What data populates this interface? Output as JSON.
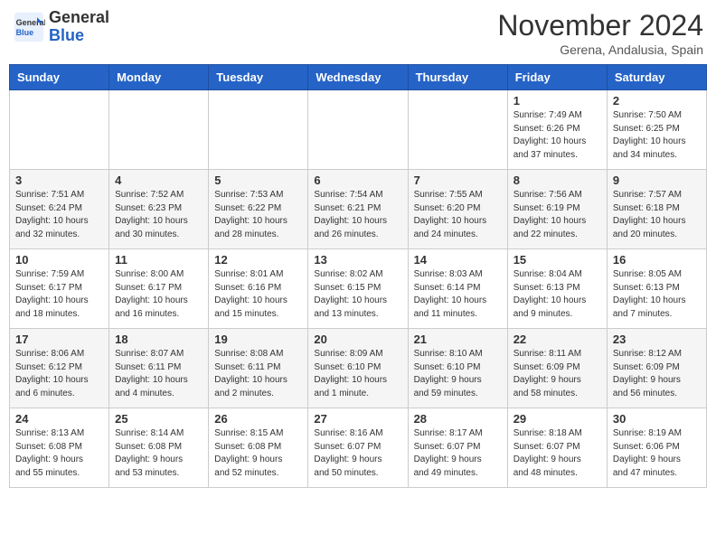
{
  "header": {
    "logo_line1": "General",
    "logo_line2": "Blue",
    "month": "November 2024",
    "location": "Gerena, Andalusia, Spain"
  },
  "weekdays": [
    "Sunday",
    "Monday",
    "Tuesday",
    "Wednesday",
    "Thursday",
    "Friday",
    "Saturday"
  ],
  "weeks": [
    [
      {
        "day": "",
        "info": ""
      },
      {
        "day": "",
        "info": ""
      },
      {
        "day": "",
        "info": ""
      },
      {
        "day": "",
        "info": ""
      },
      {
        "day": "",
        "info": ""
      },
      {
        "day": "1",
        "info": "Sunrise: 7:49 AM\nSunset: 6:26 PM\nDaylight: 10 hours\nand 37 minutes."
      },
      {
        "day": "2",
        "info": "Sunrise: 7:50 AM\nSunset: 6:25 PM\nDaylight: 10 hours\nand 34 minutes."
      }
    ],
    [
      {
        "day": "3",
        "info": "Sunrise: 7:51 AM\nSunset: 6:24 PM\nDaylight: 10 hours\nand 32 minutes."
      },
      {
        "day": "4",
        "info": "Sunrise: 7:52 AM\nSunset: 6:23 PM\nDaylight: 10 hours\nand 30 minutes."
      },
      {
        "day": "5",
        "info": "Sunrise: 7:53 AM\nSunset: 6:22 PM\nDaylight: 10 hours\nand 28 minutes."
      },
      {
        "day": "6",
        "info": "Sunrise: 7:54 AM\nSunset: 6:21 PM\nDaylight: 10 hours\nand 26 minutes."
      },
      {
        "day": "7",
        "info": "Sunrise: 7:55 AM\nSunset: 6:20 PM\nDaylight: 10 hours\nand 24 minutes."
      },
      {
        "day": "8",
        "info": "Sunrise: 7:56 AM\nSunset: 6:19 PM\nDaylight: 10 hours\nand 22 minutes."
      },
      {
        "day": "9",
        "info": "Sunrise: 7:57 AM\nSunset: 6:18 PM\nDaylight: 10 hours\nand 20 minutes."
      }
    ],
    [
      {
        "day": "10",
        "info": "Sunrise: 7:59 AM\nSunset: 6:17 PM\nDaylight: 10 hours\nand 18 minutes."
      },
      {
        "day": "11",
        "info": "Sunrise: 8:00 AM\nSunset: 6:17 PM\nDaylight: 10 hours\nand 16 minutes."
      },
      {
        "day": "12",
        "info": "Sunrise: 8:01 AM\nSunset: 6:16 PM\nDaylight: 10 hours\nand 15 minutes."
      },
      {
        "day": "13",
        "info": "Sunrise: 8:02 AM\nSunset: 6:15 PM\nDaylight: 10 hours\nand 13 minutes."
      },
      {
        "day": "14",
        "info": "Sunrise: 8:03 AM\nSunset: 6:14 PM\nDaylight: 10 hours\nand 11 minutes."
      },
      {
        "day": "15",
        "info": "Sunrise: 8:04 AM\nSunset: 6:13 PM\nDaylight: 10 hours\nand 9 minutes."
      },
      {
        "day": "16",
        "info": "Sunrise: 8:05 AM\nSunset: 6:13 PM\nDaylight: 10 hours\nand 7 minutes."
      }
    ],
    [
      {
        "day": "17",
        "info": "Sunrise: 8:06 AM\nSunset: 6:12 PM\nDaylight: 10 hours\nand 6 minutes."
      },
      {
        "day": "18",
        "info": "Sunrise: 8:07 AM\nSunset: 6:11 PM\nDaylight: 10 hours\nand 4 minutes."
      },
      {
        "day": "19",
        "info": "Sunrise: 8:08 AM\nSunset: 6:11 PM\nDaylight: 10 hours\nand 2 minutes."
      },
      {
        "day": "20",
        "info": "Sunrise: 8:09 AM\nSunset: 6:10 PM\nDaylight: 10 hours\nand 1 minute."
      },
      {
        "day": "21",
        "info": "Sunrise: 8:10 AM\nSunset: 6:10 PM\nDaylight: 9 hours\nand 59 minutes."
      },
      {
        "day": "22",
        "info": "Sunrise: 8:11 AM\nSunset: 6:09 PM\nDaylight: 9 hours\nand 58 minutes."
      },
      {
        "day": "23",
        "info": "Sunrise: 8:12 AM\nSunset: 6:09 PM\nDaylight: 9 hours\nand 56 minutes."
      }
    ],
    [
      {
        "day": "24",
        "info": "Sunrise: 8:13 AM\nSunset: 6:08 PM\nDaylight: 9 hours\nand 55 minutes."
      },
      {
        "day": "25",
        "info": "Sunrise: 8:14 AM\nSunset: 6:08 PM\nDaylight: 9 hours\nand 53 minutes."
      },
      {
        "day": "26",
        "info": "Sunrise: 8:15 AM\nSunset: 6:08 PM\nDaylight: 9 hours\nand 52 minutes."
      },
      {
        "day": "27",
        "info": "Sunrise: 8:16 AM\nSunset: 6:07 PM\nDaylight: 9 hours\nand 50 minutes."
      },
      {
        "day": "28",
        "info": "Sunrise: 8:17 AM\nSunset: 6:07 PM\nDaylight: 9 hours\nand 49 minutes."
      },
      {
        "day": "29",
        "info": "Sunrise: 8:18 AM\nSunset: 6:07 PM\nDaylight: 9 hours\nand 48 minutes."
      },
      {
        "day": "30",
        "info": "Sunrise: 8:19 AM\nSunset: 6:06 PM\nDaylight: 9 hours\nand 47 minutes."
      }
    ]
  ]
}
